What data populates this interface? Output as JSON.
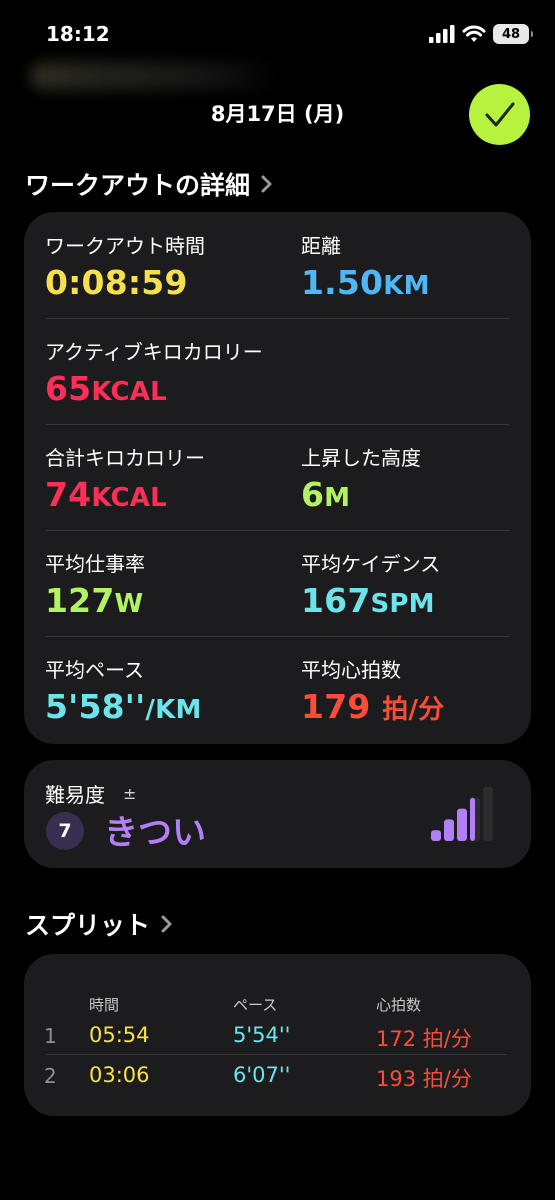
{
  "status": {
    "time": "18:12",
    "battery": "48"
  },
  "header": {
    "date": "8月17日 (月)"
  },
  "details": {
    "title": "ワークアウトの詳細",
    "workout_time": {
      "label": "ワークアウト時間",
      "value": "0:08:59"
    },
    "distance": {
      "label": "距離",
      "value": "1.50",
      "unit": "KM"
    },
    "active_kcal": {
      "label": "アクティブキロカロリー",
      "value": "65",
      "unit": "KCAL"
    },
    "total_kcal": {
      "label": "合計キロカロリー",
      "value": "74",
      "unit": "KCAL"
    },
    "elevation": {
      "label": "上昇した高度",
      "value": "6",
      "unit": "M"
    },
    "avg_power": {
      "label": "平均仕事率",
      "value": "127",
      "unit": "W"
    },
    "avg_cadence": {
      "label": "平均ケイデンス",
      "value": "167",
      "unit": "SPM"
    },
    "avg_pace": {
      "label": "平均ペース",
      "value": "5'58''",
      "unit": "/KM"
    },
    "avg_hr": {
      "label": "平均心拍数",
      "value": "179",
      "unit": "拍/分"
    }
  },
  "effort": {
    "label": "難易度",
    "adjust": "±",
    "level": "7",
    "text": "きつい",
    "level_fraction": 0.7
  },
  "splits": {
    "title": "スプリット",
    "headers": {
      "time": "時間",
      "pace": "ペース",
      "hr": "心拍数"
    },
    "rows": [
      {
        "index": "1",
        "time": "05:54",
        "pace": "5'54''",
        "hr": "172 拍/分"
      },
      {
        "index": "2",
        "time": "03:06",
        "pace": "6'07''",
        "hr": "193 拍/分"
      }
    ]
  },
  "colors": {
    "yellow": "#f6e04e",
    "blue": "#4fb7f5",
    "red": "#ff2e56",
    "green": "#b3f262",
    "cyan": "#6ce4e9",
    "orange": "#ff4b39",
    "purple": "#b27ff6",
    "done": "#b6f23e"
  }
}
